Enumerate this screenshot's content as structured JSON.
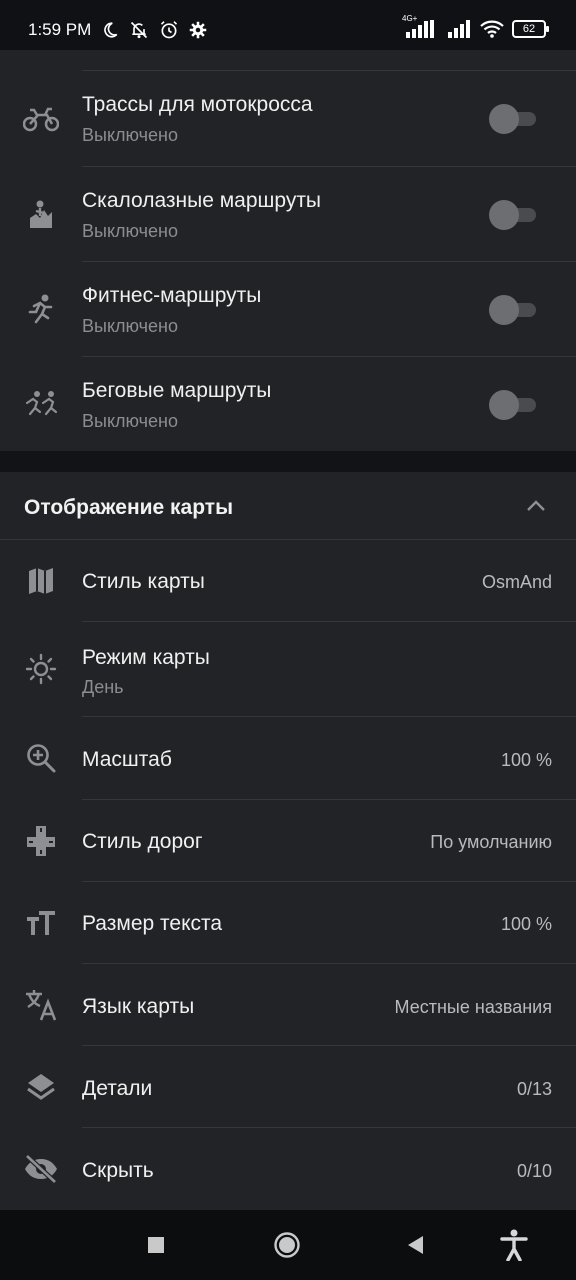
{
  "status_bar": {
    "time": "1:59 PM",
    "network": "4G+",
    "battery": "62"
  },
  "routes": [
    {
      "icon": "motocross-icon",
      "title": "Трассы для мотокросса",
      "state": "Выключено",
      "enabled": false
    },
    {
      "icon": "climbing-icon",
      "title": "Скалолазные маршруты",
      "state": "Выключено",
      "enabled": false
    },
    {
      "icon": "fitness-runner-icon",
      "title": "Фитнес-маршруты",
      "state": "Выключено",
      "enabled": false
    },
    {
      "icon": "running-group-icon",
      "title": "Беговые маршруты",
      "state": "Выключено",
      "enabled": false
    }
  ],
  "map_display": {
    "title": "Отображение карты",
    "items": [
      {
        "icon": "map-icon",
        "label": "Стиль карты",
        "value": "OsmAnd"
      },
      {
        "icon": "sun-icon",
        "label": "Режим карты",
        "value": "День"
      },
      {
        "icon": "zoom-in-icon",
        "label": "Масштаб",
        "value": "100 %"
      },
      {
        "icon": "road-icon",
        "label": "Стиль дорог",
        "value": "По умолчанию"
      },
      {
        "icon": "text-size-icon",
        "label": "Размер текста",
        "value": "100 %"
      },
      {
        "icon": "translate-icon",
        "label": "Язык карты",
        "value": "Местные названия"
      },
      {
        "icon": "layers-icon",
        "label": "Детали",
        "value": "0/13"
      },
      {
        "icon": "eye-off-icon",
        "label": "Скрыть",
        "value": "0/10"
      }
    ]
  },
  "colors": {
    "background": "#1c1d20",
    "card": "#222326",
    "divider": "#34363a",
    "secondary_text": "#8c8d90"
  }
}
